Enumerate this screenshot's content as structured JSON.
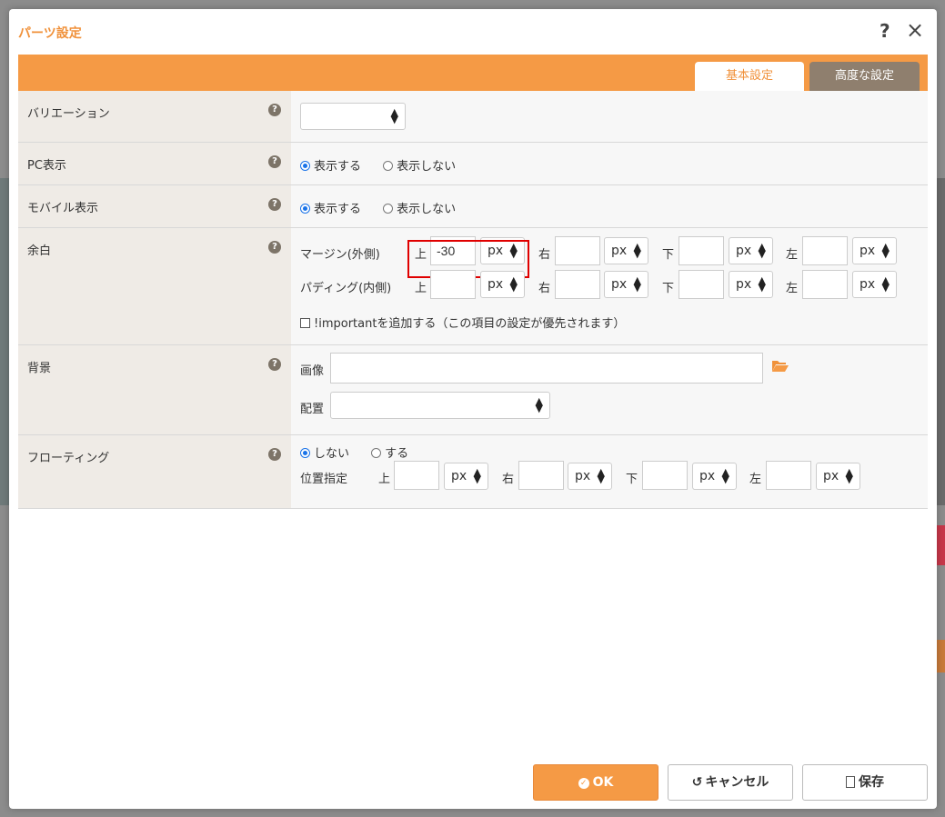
{
  "dialog": {
    "title": "パーツ設定",
    "help_icon": "?",
    "close_icon": "×"
  },
  "tabs": [
    {
      "label": "基本設定",
      "active": true
    },
    {
      "label": "高度な設定",
      "active": false
    }
  ],
  "rows": {
    "variation": {
      "label": "バリエーション",
      "select_value": ""
    },
    "pc": {
      "label": "PC表示",
      "options": [
        "表示する",
        "表示しない"
      ],
      "selected": "表示する"
    },
    "mobile": {
      "label": "モバイル表示",
      "options": [
        "表示する",
        "表示しない"
      ],
      "selected": "表示する"
    },
    "margin": {
      "label": "余白",
      "outer_label": "マージン(外側)",
      "inner_label": "パディング(内側)",
      "sides": [
        "上",
        "右",
        "下",
        "左"
      ],
      "outer_values": [
        "-30",
        "",
        "",
        ""
      ],
      "inner_values": [
        "",
        "",
        "",
        ""
      ],
      "unit": "px",
      "important_label": "!importantを追加する（この項目の設定が優先されます）"
    },
    "background": {
      "label": "背景",
      "image_label": "画像",
      "image_value": "",
      "placement_label": "配置",
      "placement_value": ""
    },
    "floating": {
      "label": "フローティング",
      "options": [
        "しない",
        "する"
      ],
      "selected": "しない",
      "position_label": "位置指定",
      "sides": [
        "上",
        "右",
        "下",
        "左"
      ],
      "values": [
        "",
        "",
        "",
        ""
      ],
      "unit": "px"
    }
  },
  "buttons": {
    "ok": "OK",
    "cancel": "キャンセル",
    "save": "保存"
  },
  "colors": {
    "accent": "#f59a45",
    "tab_inactive": "#8f7f6e",
    "highlight": "#e00000"
  }
}
